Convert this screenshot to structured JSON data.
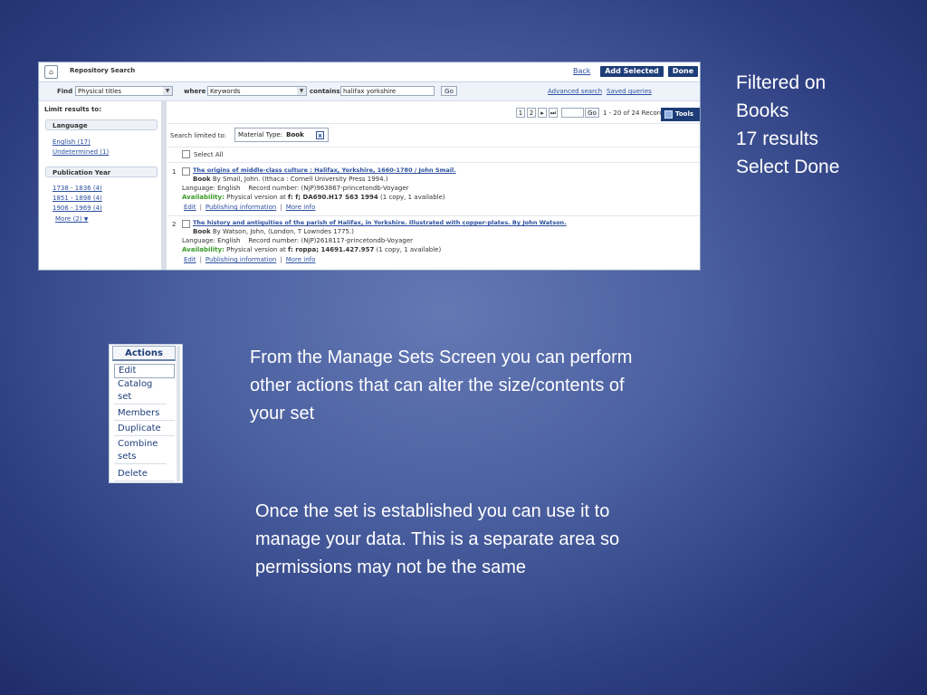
{
  "screenshot": {
    "title": "Repository Search",
    "back": "Back",
    "add_selected": "Add Selected",
    "done": "Done",
    "find_label": "Find",
    "find_value": "Physical titles",
    "where_label": "where",
    "where_value": "Keywords",
    "contains_label": "contains",
    "query": "halifax yorkshire",
    "go": "Go",
    "advanced_search": "Advanced search",
    "saved_queries": "Saved queries",
    "limit_header": "Limit results to:",
    "language_group": "Language",
    "language_items": [
      "English (17)",
      "Undetermined (1)"
    ],
    "pubyear_group": "Publication Year",
    "pubyear_items": [
      "1738 - 1836 (4)",
      "1851 - 1898 (4)",
      "1906 - 1969 (4)"
    ],
    "more": "More (2)",
    "pager_pages": [
      "1",
      "2",
      "▸",
      "⏭"
    ],
    "pager_go": "Go",
    "record_count": "1 - 20 of 24 Records",
    "tools": "Tools",
    "search_limited": "Search limited to:",
    "material_type_label": "Material Type:",
    "material_type_value": "Book",
    "chip_close": "x",
    "select_all": "Select All",
    "records": [
      {
        "num": "1",
        "title": "The origins of middle-class culture : Halifax, Yorkshire, 1660-1780 / John Smail.",
        "type": "Book",
        "byline": "By Smail, John. (Ithaca : Cornell University Press 1994.)",
        "language_label": "Language:",
        "language": "English",
        "recnum_label": "Record number:",
        "recnum": "(NjP)963867-princetondb-Voyager",
        "avail_label": "Availability:",
        "avail_pre": "Physical version at",
        "avail_loc": "f: f; DA690.H17 S63 1994",
        "avail_post": "(1 copy, 1 available)",
        "links": [
          "Edit",
          "Publishing information",
          "More info"
        ]
      },
      {
        "num": "2",
        "title": "The history and antiquities of the parish of Halifax, in Yorkshire. Illustrated with copper-plates. By John Watson.",
        "type": "Book",
        "byline": "By Watson, John, (London, T Lowndes 1775.)",
        "language_label": "Language:",
        "language": "English",
        "recnum_label": "Record number:",
        "recnum": "(NjP)2618117-princetondb-Voyager",
        "avail_label": "Availability:",
        "avail_pre": "Physical version at",
        "avail_loc": "f: roppa; 14691.427.957",
        "avail_post": "(1 copy, 1 available)",
        "links": [
          "Edit",
          "Publishing information",
          "More info"
        ]
      }
    ]
  },
  "actions_menu": {
    "header": "Actions",
    "items": [
      "Edit",
      "Catalog set",
      "Members",
      "Duplicate",
      "Combine sets",
      "Delete"
    ]
  },
  "notes": {
    "top": [
      "Filtered on",
      "Books",
      "17 results",
      "Select Done"
    ],
    "middle": [
      "From the Manage Sets Screen you can perform",
      "other actions that can alter the size/contents of",
      "your set"
    ],
    "bottom": [
      "Once the set is established you can use it to",
      "manage your data. This is a separate area so",
      "permissions may not be the same"
    ]
  }
}
